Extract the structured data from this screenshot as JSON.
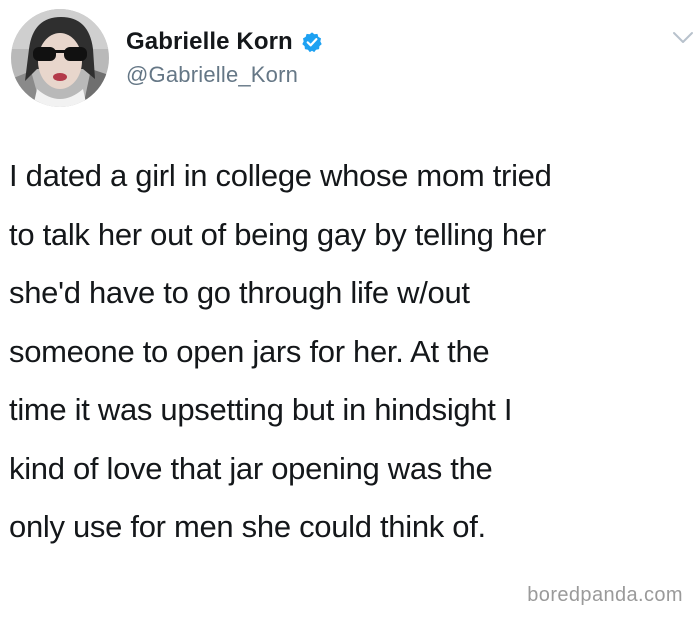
{
  "author": {
    "display_name": "Gabrielle Korn",
    "handle": "@Gabrielle_Korn",
    "verified": true,
    "verified_color": "#1da1f2"
  },
  "icons": {
    "avatar": "profile-photo",
    "verified": "verified-badge-icon",
    "menu": "chevron-down-icon"
  },
  "tweet": {
    "lines": [
      "I dated a girl in college whose mom tried",
      "to talk her out of being gay by telling her",
      "she'd have to go through life w/out",
      "someone to open jars for her. At the",
      "time it was upsetting but in hindsight I",
      "kind of love that jar opening was the",
      "only use for men she could think of."
    ]
  },
  "watermark": "boredpanda.com"
}
